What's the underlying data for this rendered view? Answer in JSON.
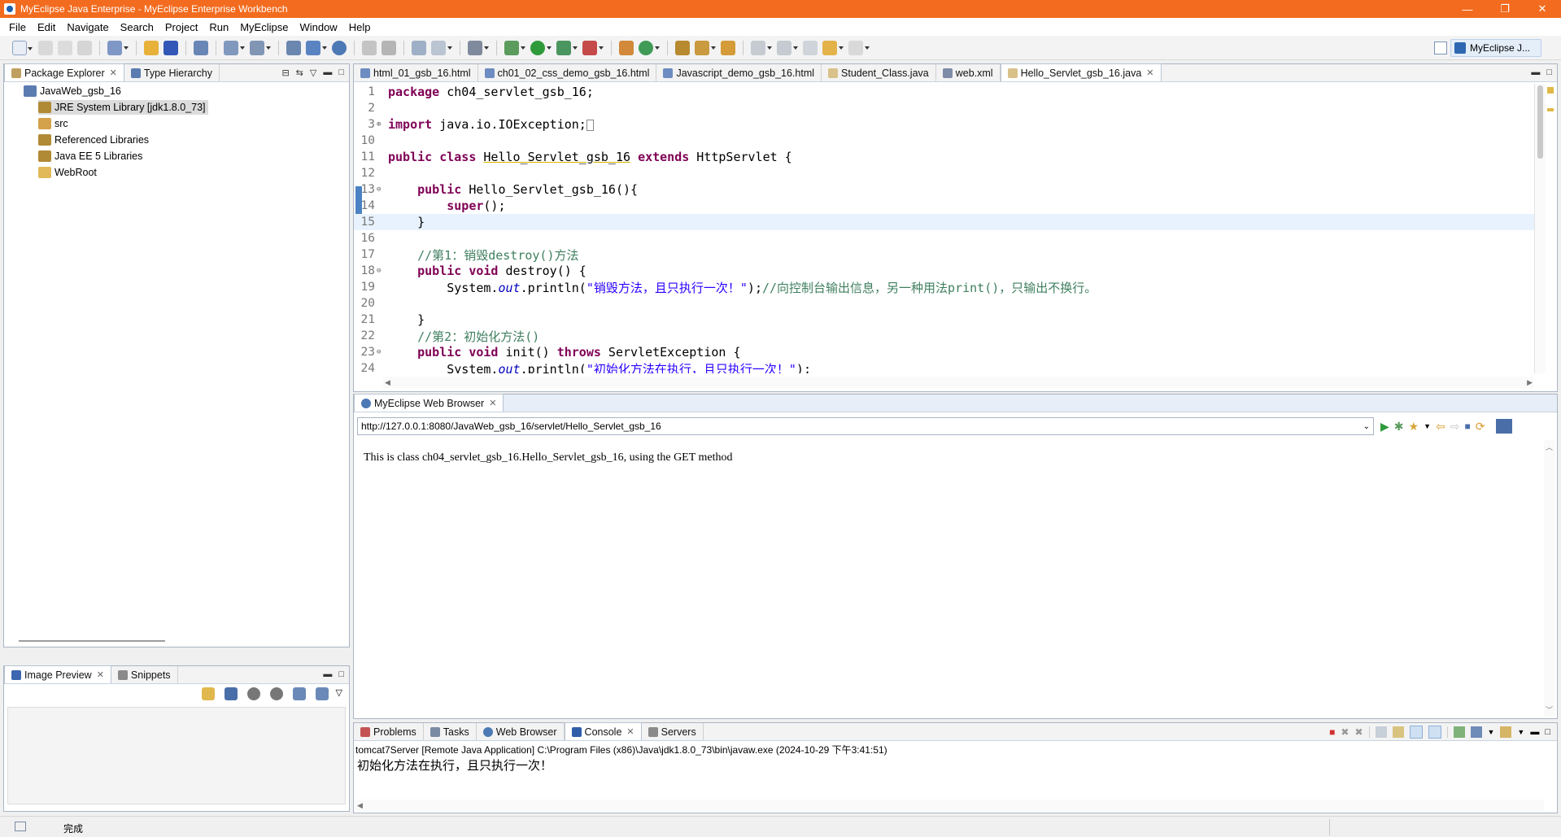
{
  "window": {
    "title": "MyEclipse Java Enterprise - MyEclipse Enterprise Workbench",
    "minimize": "—",
    "maximize": "❐",
    "close": "✕"
  },
  "menu": [
    "File",
    "Edit",
    "Navigate",
    "Search",
    "Project",
    "Run",
    "MyEclipse",
    "Window",
    "Help"
  ],
  "perspective": {
    "label": "MyEclipse J..."
  },
  "package_explorer": {
    "tabs": [
      {
        "label": "Package Explorer"
      },
      {
        "label": "Type Hierarchy"
      }
    ],
    "tree": [
      {
        "label": "JavaWeb_gsb_16",
        "icon": "project-icon"
      },
      {
        "label": "JRE System Library [jdk1.8.0_73]",
        "icon": "library-icon"
      },
      {
        "label": "src",
        "icon": "source-folder-icon"
      },
      {
        "label": "Referenced Libraries",
        "icon": "library-icon"
      },
      {
        "label": "Java EE 5 Libraries",
        "icon": "library-icon"
      },
      {
        "label": "WebRoot",
        "icon": "folder-icon"
      }
    ]
  },
  "image_preview": {
    "tabs": [
      {
        "label": "Image Preview"
      },
      {
        "label": "Snippets"
      }
    ]
  },
  "editor": {
    "tabs": [
      {
        "label": "html_01_gsb_16.html"
      },
      {
        "label": "ch01_02_css_demo_gsb_16.html"
      },
      {
        "label": "Javascript_demo_gsb_16.html"
      },
      {
        "label": "Student_Class.java"
      },
      {
        "label": "web.xml"
      },
      {
        "label": "Hello_Servlet_gsb_16.java"
      }
    ],
    "line_numbers": [
      "1",
      "2",
      "3",
      "10",
      "11",
      "12",
      "13",
      "14",
      "15",
      "16",
      "17",
      "18",
      "19",
      "20",
      "21",
      "22",
      "23",
      "24"
    ]
  },
  "browser": {
    "tab": "MyEclipse Web Browser",
    "url": "http://127.0.0.1:8080/JavaWeb_gsb_16/servlet/Hello_Servlet_gsb_16",
    "content": "This is class ch04_servlet_gsb_16.Hello_Servlet_gsb_16, using the GET method"
  },
  "console": {
    "tabs": [
      {
        "label": "Problems"
      },
      {
        "label": "Tasks"
      },
      {
        "label": "Web Browser"
      },
      {
        "label": "Console"
      },
      {
        "label": "Servers"
      }
    ],
    "header": "tomcat7Server [Remote Java Application] C:\\Program Files (x86)\\Java\\jdk1.8.0_73\\bin\\javaw.exe (2024-10-29 下午3:41:51)",
    "output": "初始化方法在执行，且只执行一次！"
  },
  "status": {
    "text": "完成"
  }
}
